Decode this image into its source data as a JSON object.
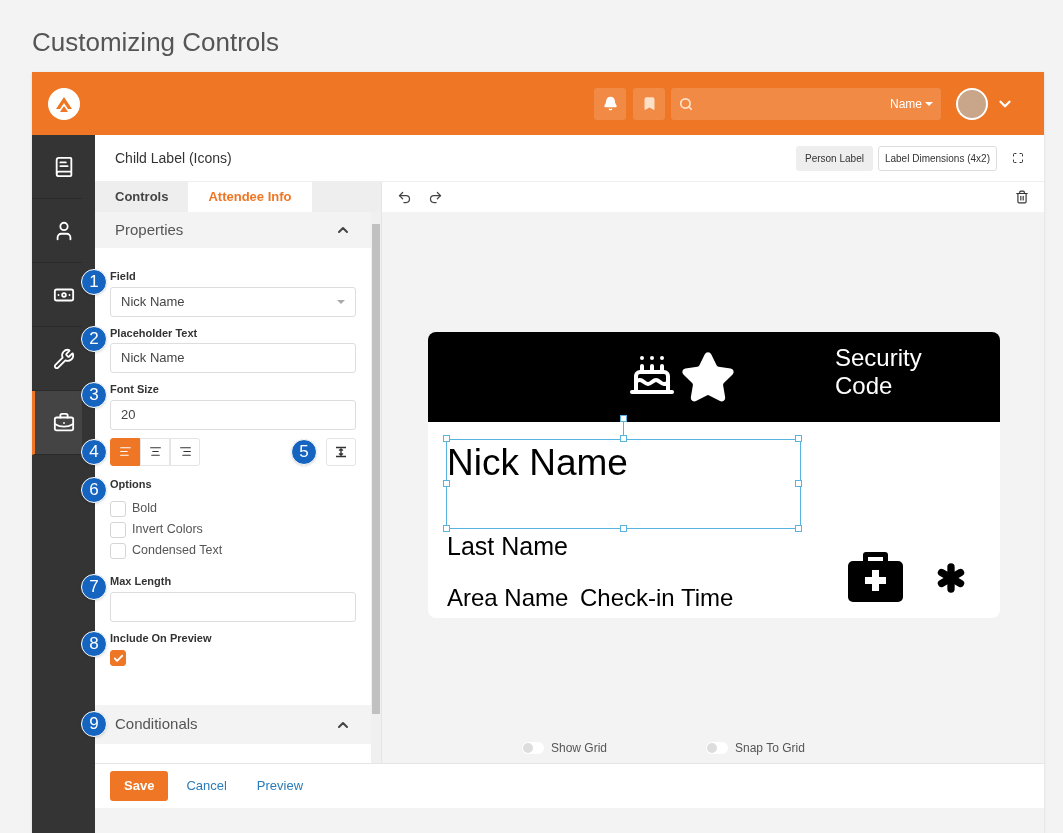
{
  "page_heading": "Customizing Controls",
  "header": {
    "search": {
      "filter": "Name"
    }
  },
  "sidebar": {
    "items": [
      {
        "selected": false
      },
      {
        "selected": false
      },
      {
        "selected": false
      },
      {
        "selected": false
      },
      {
        "selected": true
      }
    ]
  },
  "editor": {
    "title": "Child Label (Icons)",
    "label_type": "Person Label",
    "dimensions": "Label Dimensions (4x2)"
  },
  "tabs": [
    {
      "label": "Controls",
      "selected": false
    },
    {
      "label": "Attendee Info",
      "selected": true
    }
  ],
  "properties": {
    "title": "Properties",
    "expanded": true,
    "fields": [
      {
        "kind": "select",
        "callout": "1",
        "label": "Field",
        "value": "Nick Name"
      },
      {
        "kind": "text",
        "callout": "2",
        "label": "Placeholder Text",
        "value": "Nick Name"
      },
      {
        "kind": "text",
        "callout": "3",
        "label": "Font Size",
        "value": "20"
      },
      {
        "kind": "align",
        "callout": "4",
        "callout_2": "5",
        "options": [
          {
            "kind": "left",
            "selected": true
          },
          {
            "kind": "center",
            "selected": false
          },
          {
            "kind": "right",
            "selected": false
          }
        ]
      },
      {
        "kind": "options",
        "callout": "6",
        "label": "Options",
        "options": [
          {
            "label": "Bold",
            "checked": false
          },
          {
            "label": "Invert Colors",
            "checked": false
          },
          {
            "label": "Condensed Text",
            "checked": false
          }
        ]
      },
      {
        "kind": "text",
        "callout": "7",
        "label": "Max Length"
      },
      {
        "kind": "checkbox",
        "callout": "8",
        "label": "Include On Preview",
        "checked": true
      }
    ]
  },
  "conditionals": {
    "callout": "9",
    "title": "Conditionals",
    "expanded": true
  },
  "label_preview": {
    "security_code": "Security Code",
    "nick_name": "Nick Name",
    "nick_name_selected": true,
    "last_name": "Last Name",
    "area_name": "Area Name",
    "checkin_time": "Check-in Time"
  },
  "toggles": [
    {
      "label": "Show Grid",
      "on": false
    },
    {
      "label": "Snap To Grid",
      "on": false
    }
  ],
  "footer": {
    "save": "Save",
    "cancel": "Cancel",
    "preview": "Preview"
  }
}
